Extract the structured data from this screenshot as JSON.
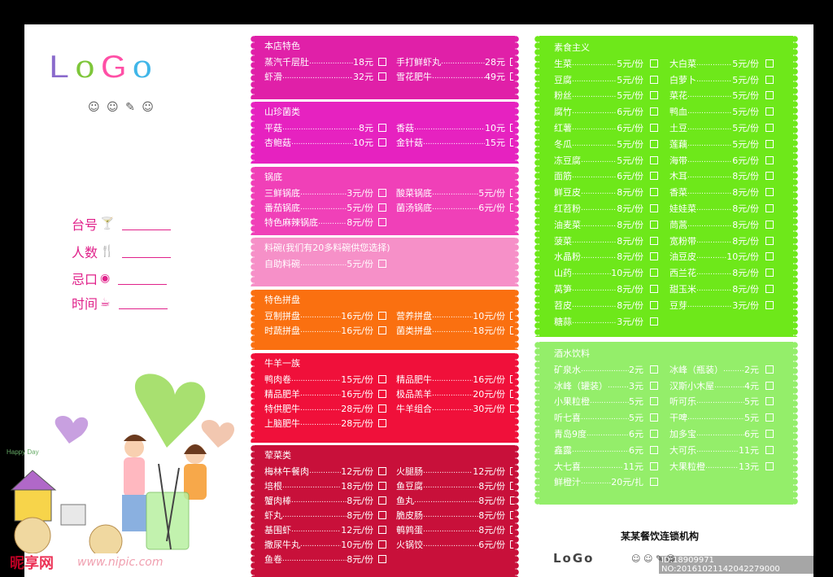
{
  "logo": {
    "l": "L",
    "o1": "o",
    "g": "G",
    "o2": "o",
    "deco": "☺ ☺ ✎ ☺"
  },
  "form": [
    {
      "label": "台号",
      "icon": "cocktail-icon",
      "glyph": "🍸"
    },
    {
      "label": "人数",
      "icon": "utensils-icon",
      "glyph": "🍴"
    },
    {
      "label": "忌口",
      "icon": "ball-icon",
      "glyph": "◉"
    },
    {
      "label": "时间",
      "icon": "coffee-icon",
      "glyph": "☕"
    }
  ],
  "art": {
    "happy_day": "Happy Day"
  },
  "watermark": {
    "brand": "昵享网",
    "url": "www.nipic.com"
  },
  "sections": [
    {
      "title": "本店特色",
      "color": "#e020a8",
      "rows": [
        [
          [
            "蒸汽千层肚",
            "18元"
          ],
          [
            "手打鲜虾丸",
            "28元"
          ]
        ],
        [
          [
            "虾滑",
            "32元"
          ],
          [
            "雪花肥牛",
            "49元"
          ]
        ]
      ]
    },
    {
      "title": "山珍菌类",
      "color": "#e622c0",
      "rows": [
        [
          [
            "平菇",
            "8元"
          ],
          [
            "香菇",
            "10元"
          ]
        ],
        [
          [
            "杏鲍菇",
            "10元"
          ],
          [
            "金针菇",
            "15元"
          ]
        ]
      ]
    },
    {
      "title": "锅底",
      "color": "#f040b8",
      "rows": [
        [
          [
            "三鲜锅底",
            "3元/份"
          ],
          [
            "酸菜锅底",
            "5元/份"
          ]
        ],
        [
          [
            "番茄锅底",
            "5元/份"
          ],
          [
            "菌汤锅底",
            "6元/份"
          ]
        ],
        [
          [
            "特色麻辣锅底",
            "8元/份"
          ],
          null
        ]
      ]
    },
    {
      "title": "料碗(我们有20多料碗供您选择)",
      "color": "#f690c8",
      "rows": [
        [
          [
            "自助料碗",
            "5元/份"
          ],
          null
        ]
      ]
    },
    {
      "title": "特色拼盘",
      "color": "#fa7010",
      "rows": [
        [
          [
            "豆制拼盘",
            "16元/份"
          ],
          [
            "营养拼盘",
            "10元/份"
          ]
        ],
        [
          [
            "时蔬拼盘",
            "16元/份"
          ],
          [
            "菌类拼盘",
            "18元/份"
          ]
        ]
      ]
    },
    {
      "title": "牛羊一族",
      "color": "#f0103a",
      "rows": [
        [
          [
            "鸭肉卷",
            "15元/份"
          ],
          [
            "精品肥牛",
            "16元/份"
          ]
        ],
        [
          [
            "精品肥羊",
            "16元/份"
          ],
          [
            "极品羔羊",
            "20元/份"
          ]
        ],
        [
          [
            "特供肥牛",
            "28元/份"
          ],
          [
            "牛羊组合",
            "30元/份"
          ]
        ],
        [
          [
            "上脑肥牛",
            "28元/份"
          ],
          null
        ]
      ]
    },
    {
      "title": "荤菜类",
      "color": "#c8103a",
      "rows": [
        [
          [
            "梅林午餐肉",
            "12元/份"
          ],
          [
            "火腿肠",
            "12元/份"
          ]
        ],
        [
          [
            "培根",
            "18元/份"
          ],
          [
            "鱼豆腐",
            "8元/份"
          ]
        ],
        [
          [
            "蟹肉棒",
            "8元/份"
          ],
          [
            "鱼丸",
            "8元/份"
          ]
        ],
        [
          [
            "虾丸",
            "8元/份"
          ],
          [
            "脆皮肠",
            "8元/份"
          ]
        ],
        [
          [
            "基围虾",
            "12元/份"
          ],
          [
            "鹌鹑蛋",
            "8元/份"
          ]
        ],
        [
          [
            "撒尿牛丸",
            "10元/份"
          ],
          [
            "火锅饺",
            "6元/份"
          ]
        ],
        [
          [
            "鱼卷",
            "8元/份"
          ],
          null
        ]
      ]
    }
  ],
  "veg": {
    "title": "素食主义",
    "color": "#6ee81a",
    "rows": [
      [
        [
          "生菜",
          "5元/份"
        ],
        [
          "大白菜",
          "5元/份"
        ]
      ],
      [
        [
          "豆腐",
          "5元/份"
        ],
        [
          "白萝卜",
          "5元/份"
        ]
      ],
      [
        [
          "粉丝",
          "5元/份"
        ],
        [
          "菜花",
          "5元/份"
        ]
      ],
      [
        [
          "腐竹",
          "6元/份"
        ],
        [
          "鸭血",
          "5元/份"
        ]
      ],
      [
        [
          "红薯",
          "6元/份"
        ],
        [
          "土豆",
          "5元/份"
        ]
      ],
      [
        [
          "冬瓜",
          "5元/份"
        ],
        [
          "莲藕",
          "5元/份"
        ]
      ],
      [
        [
          "冻豆腐",
          "5元/份"
        ],
        [
          "海带",
          "6元/份"
        ]
      ],
      [
        [
          "面筋",
          "6元/份"
        ],
        [
          "木耳",
          "8元/份"
        ]
      ],
      [
        [
          "鲜豆皮",
          "8元/份"
        ],
        [
          "香菜",
          "8元/份"
        ]
      ],
      [
        [
          "红苕粉",
          "8元/份"
        ],
        [
          "娃娃菜",
          "8元/份"
        ]
      ],
      [
        [
          "油麦菜",
          "8元/份"
        ],
        [
          "茼蒿",
          "8元/份"
        ]
      ],
      [
        [
          "菠菜",
          "8元/份"
        ],
        [
          "宽粉带",
          "8元/份"
        ]
      ],
      [
        [
          "水晶粉",
          "8元/份"
        ],
        [
          "油豆皮",
          "10元/份"
        ]
      ],
      [
        [
          "山药",
          "10元/份"
        ],
        [
          "西兰花",
          "8元/份"
        ]
      ],
      [
        [
          "莴笋",
          "8元/份"
        ],
        [
          "甜玉米",
          "8元/份"
        ]
      ],
      [
        [
          "苕皮",
          "8元/份"
        ],
        [
          "豆芽",
          "3元/份"
        ]
      ],
      [
        [
          "糖蒜",
          "3元/份"
        ],
        null
      ]
    ]
  },
  "drinks": {
    "title": "酒水饮料",
    "color": "#94ee6a",
    "rows": [
      [
        [
          "矿泉水",
          "2元"
        ],
        [
          "冰峰（瓶装）",
          "2元"
        ]
      ],
      [
        [
          "冰峰（罐装）",
          "3元"
        ],
        [
          "汉斯小木屋",
          "4元"
        ]
      ],
      [
        [
          "小果粒橙",
          "5元"
        ],
        [
          "听可乐",
          "5元"
        ]
      ],
      [
        [
          "听七喜",
          "5元"
        ],
        [
          "干啤",
          "5元"
        ]
      ],
      [
        [
          "青岛9度",
          "6元"
        ],
        [
          "加多宝",
          "6元"
        ]
      ],
      [
        [
          "鑫露",
          "6元"
        ],
        [
          "大可乐",
          "11元"
        ]
      ],
      [
        [
          "大七喜",
          "11元"
        ],
        [
          "大果粒橙",
          "13元"
        ]
      ],
      [
        [
          "鲜橙汁",
          "20元/扎"
        ],
        null
      ]
    ]
  },
  "footer": {
    "brand": "某某餐饮连锁机构",
    "logo": "LoGo",
    "icons": "☺ ☺ ✎ ☺",
    "code": "ID:18909971 NO:20161021142042279000"
  }
}
